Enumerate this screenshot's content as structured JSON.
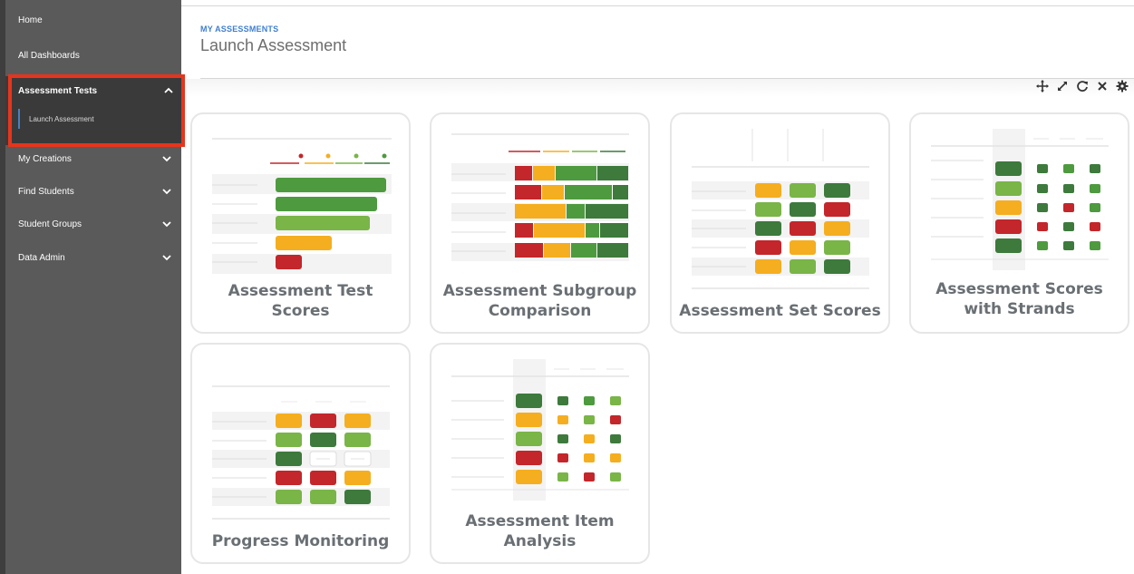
{
  "sidebar": {
    "home": "Home",
    "all_dashboards": "All Dashboards",
    "assessment_tests": "Assessment Tests",
    "launch_assessment": "Launch Assessment",
    "my_creations": "My Creations",
    "find_students": "Find Students",
    "student_groups": "Student Groups",
    "data_admin": "Data Admin"
  },
  "header": {
    "breadcrumb": "MY ASSESSMENTS",
    "title": "Launch Assessment"
  },
  "toolbar": {
    "icons": [
      "move-icon",
      "expand-icon",
      "refresh-icon",
      "close-icon",
      "gear-icon"
    ]
  },
  "cards": {
    "test_scores": "Assessment Test Scores",
    "subgroup_line1": "Assessment Subgroup",
    "subgroup_line2": "Comparison",
    "set_scores": "Assessment Set Scores",
    "strands_line1": "Assessment Scores",
    "strands_line2": "with Strands",
    "progress": "Progress Monitoring",
    "item_line1": "Assessment Item",
    "item_line2": "Analysis"
  },
  "colors": {
    "dark_green": "#3d7a3c",
    "green": "#4e9a3f",
    "light_green": "#79b547",
    "yellow": "#f5ae1f",
    "red": "#c3262b",
    "highlight": "#e8341c",
    "accent_blue": "#3f7fd0"
  }
}
